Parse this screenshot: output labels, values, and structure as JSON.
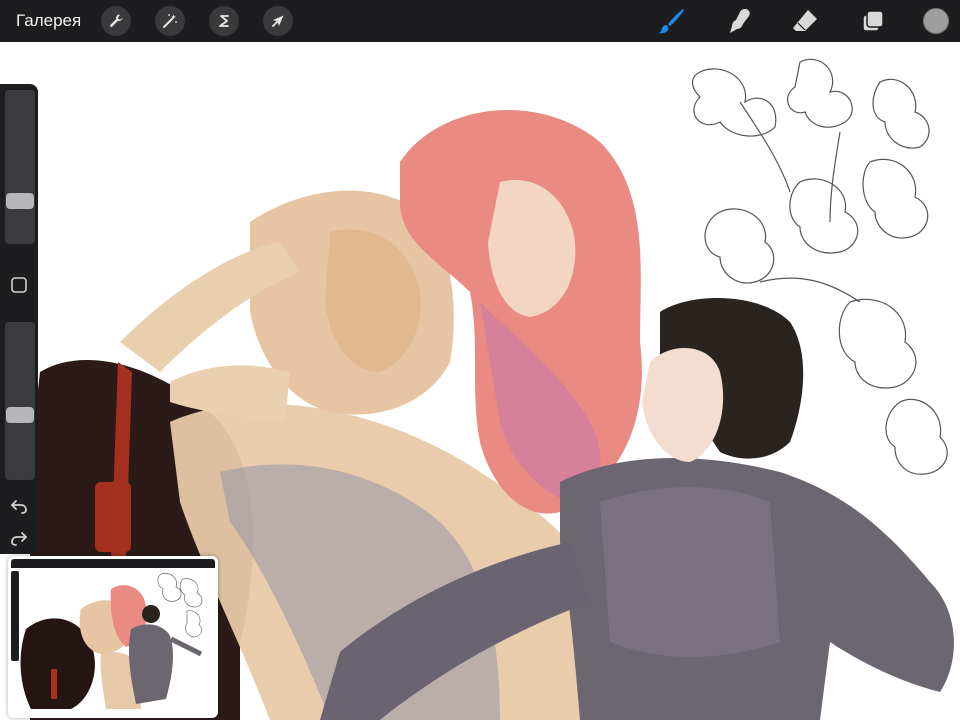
{
  "toolbar": {
    "gallery_label": "Галерея",
    "left_actions": [
      {
        "name": "actions-button",
        "icon": "wrench-icon"
      },
      {
        "name": "adjustments-button",
        "icon": "magic-wand-icon"
      },
      {
        "name": "selection-button",
        "icon": "selection-s-icon"
      },
      {
        "name": "transform-button",
        "icon": "arrow-cursor-icon"
      }
    ],
    "right_tools": [
      {
        "name": "brush-tool",
        "icon": "brush-icon",
        "active": true
      },
      {
        "name": "smudge-tool",
        "icon": "smudge-icon",
        "active": false
      },
      {
        "name": "eraser-tool",
        "icon": "eraser-icon",
        "active": false
      },
      {
        "name": "layers-button",
        "icon": "layers-icon",
        "active": false
      }
    ],
    "current_color": "#9e9e9e",
    "accent_color": "#1c8cf0"
  },
  "sidebar": {
    "brush_size_level": 0.25,
    "opacity_level": 0.4
  },
  "colors": {
    "hair": "#e98a83",
    "dress": "#e7c9a8",
    "armor": "#6c6670",
    "dark_hair": "#2a2420",
    "horse": "#2b1a18",
    "bridle": "#a5301f"
  }
}
